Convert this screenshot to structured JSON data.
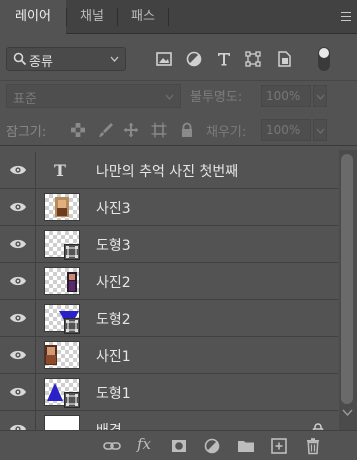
{
  "tabs": [
    {
      "label": "레이어",
      "active": true
    },
    {
      "label": "채널",
      "active": false
    },
    {
      "label": "패스",
      "active": false
    }
  ],
  "filter": {
    "kind_label": "종류"
  },
  "blend": {
    "mode": "표준",
    "opacity_label": "불투명도:",
    "opacity_value": "100%"
  },
  "lock": {
    "label": "잠그기:",
    "fill_label": "채우기:",
    "fill_value": "100%"
  },
  "layers": [
    {
      "name": "나만의 추억 사진 첫번째",
      "type": "text"
    },
    {
      "name": "사진3",
      "type": "image"
    },
    {
      "name": "도형3",
      "type": "shape"
    },
    {
      "name": "사진2",
      "type": "image"
    },
    {
      "name": "도형2",
      "type": "shape"
    },
    {
      "name": "사진1",
      "type": "image"
    },
    {
      "name": "도형1",
      "type": "shape"
    },
    {
      "name": "배경",
      "type": "background",
      "locked": true
    }
  ],
  "colors": {
    "panel": "#535353",
    "tabbar": "#424242",
    "shape_blue": "#2a22c8"
  }
}
